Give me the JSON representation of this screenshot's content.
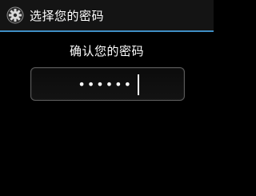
{
  "titlebar": {
    "icon": "gear-icon",
    "title": "选择您的密码"
  },
  "main": {
    "prompt": "确认您的密码",
    "password_masked": "••••••"
  },
  "colors": {
    "background": "#000000",
    "accent_divider": "#3f8ec4",
    "text": "#ffffff"
  }
}
